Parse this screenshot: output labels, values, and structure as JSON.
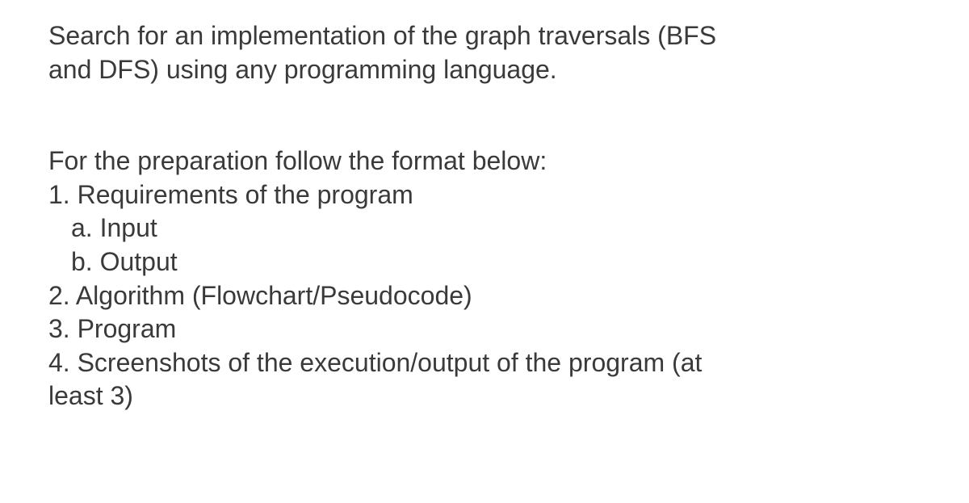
{
  "intro": {
    "line1": "Search for an implementation of the graph traversals (BFS",
    "line2": "and DFS) using any programming language."
  },
  "format": {
    "heading": "For the preparation follow the format below:",
    "item1": "1.  Requirements of the program",
    "item1a": "a.  Input",
    "item1b": "b. Output",
    "item2": "2.  Algorithm (Flowchart/Pseudocode)",
    "item3": "3.  Program",
    "item4": "4.  Screenshots of the execution/output of the program (at",
    "item4cont": "least 3)"
  }
}
